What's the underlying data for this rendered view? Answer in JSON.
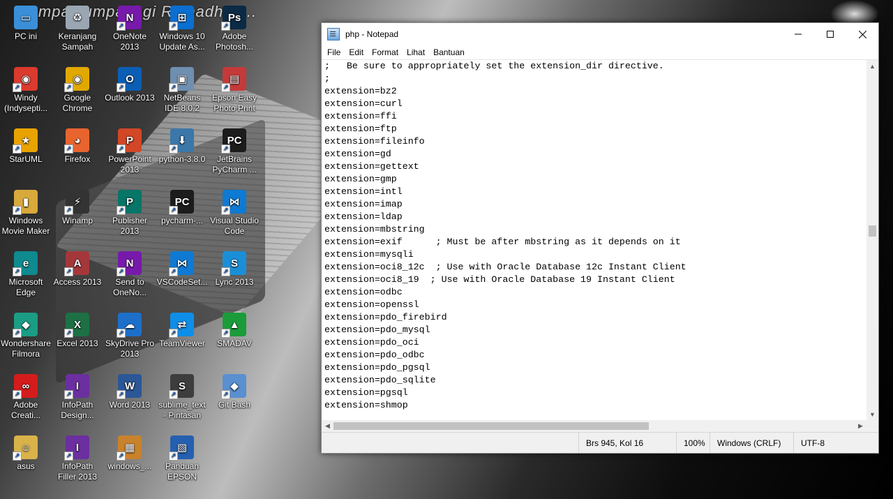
{
  "desktop": {
    "banner": "Sampai jumpa lagi Ramadhan...",
    "icons": [
      {
        "label": "PC ini",
        "icon": "pc-icon",
        "color": "#3a8fd8",
        "glyph": "▭"
      },
      {
        "label": "Keranjang Sampah",
        "icon": "recycle-bin-icon",
        "color": "#9aa7b3",
        "glyph": "♻"
      },
      {
        "label": "OneNote 2013",
        "icon": "onenote-icon",
        "color": "#7719aa",
        "glyph": "N"
      },
      {
        "label": "Windows 10 Update As...",
        "icon": "windows-update-icon",
        "color": "#0a6fd1",
        "glyph": "⊞"
      },
      {
        "label": "Adobe Photosh...",
        "icon": "photoshop-icon",
        "color": "#0b2a45",
        "glyph": "Ps"
      },
      {
        "label": "Windy (Indysepti...",
        "icon": "chrome-profile-icon",
        "color": "#db3a2e",
        "glyph": "◉"
      },
      {
        "label": "Google Chrome",
        "icon": "chrome-icon",
        "color": "#e1a800",
        "glyph": "◉"
      },
      {
        "label": "Outlook 2013",
        "icon": "outlook-icon",
        "color": "#0a5fb5",
        "glyph": "O"
      },
      {
        "label": "NetBeans IDE 8.0.2",
        "icon": "netbeans-icon",
        "color": "#6f8fb0",
        "glyph": "▣"
      },
      {
        "label": "Epson Easy Photo Print",
        "icon": "epson-photo-icon",
        "color": "#c43a3a",
        "glyph": "▤"
      },
      {
        "label": "StarUML",
        "icon": "staruml-icon",
        "color": "#e8a300",
        "glyph": "★"
      },
      {
        "label": "Firefox",
        "icon": "firefox-icon",
        "color": "#e8642e",
        "glyph": "◕"
      },
      {
        "label": "PowerPoint 2013",
        "icon": "powerpoint-icon",
        "color": "#d24726",
        "glyph": "P"
      },
      {
        "label": "python-3.8.0",
        "icon": "python-installer-icon",
        "color": "#3b77a8",
        "glyph": "⬇"
      },
      {
        "label": "JetBrains PyCharm ...",
        "icon": "pycharm-icon",
        "color": "#1c1c1c",
        "glyph": "PC"
      },
      {
        "label": "Windows Movie Maker",
        "icon": "movie-maker-icon",
        "color": "#d8a93b",
        "glyph": "▮"
      },
      {
        "label": "Winamp",
        "icon": "winamp-icon",
        "color": "#333333",
        "glyph": "⚡"
      },
      {
        "label": "Publisher 2013",
        "icon": "publisher-icon",
        "color": "#077568",
        "glyph": "P"
      },
      {
        "label": "pycharm-...",
        "icon": "pycharm-installer-icon",
        "color": "#1c1c1c",
        "glyph": "PC"
      },
      {
        "label": "Visual Studio Code",
        "icon": "vscode-icon",
        "color": "#0e7ad3",
        "glyph": "⋈"
      },
      {
        "label": "Microsoft Edge",
        "icon": "edge-icon",
        "color": "#0f8a8f",
        "glyph": "e"
      },
      {
        "label": "Access 2013",
        "icon": "access-icon",
        "color": "#a4373a",
        "glyph": "A"
      },
      {
        "label": "Send to OneNo...",
        "icon": "send-to-onenote-icon",
        "color": "#7719aa",
        "glyph": "N"
      },
      {
        "label": "VSCodeSet...",
        "icon": "vscode-setup-icon",
        "color": "#0e7ad3",
        "glyph": "⋈"
      },
      {
        "label": "Lync 2013",
        "icon": "lync-icon",
        "color": "#1a8fd8",
        "glyph": "S"
      },
      {
        "label": "Wondershare Filmora",
        "icon": "filmora-icon",
        "color": "#1b9c85",
        "glyph": "◆"
      },
      {
        "label": "Excel 2013",
        "icon": "excel-icon",
        "color": "#1d7044",
        "glyph": "X"
      },
      {
        "label": "SkyDrive Pro 2013",
        "icon": "skydrive-icon",
        "color": "#1e6fc9",
        "glyph": "☁"
      },
      {
        "label": "TeamViewer",
        "icon": "teamviewer-icon",
        "color": "#0e8ee9",
        "glyph": "⇄"
      },
      {
        "label": "SMADAV",
        "icon": "smadav-icon",
        "color": "#1b9c3a",
        "glyph": "▲"
      },
      {
        "label": "Adobe Creati...",
        "icon": "adobe-cc-icon",
        "color": "#d41c1c",
        "glyph": "∞"
      },
      {
        "label": "InfoPath Design...",
        "icon": "infopath-designer-icon",
        "color": "#6b2fa0",
        "glyph": "I"
      },
      {
        "label": "Word 2013",
        "icon": "word-icon",
        "color": "#2b5797",
        "glyph": "W"
      },
      {
        "label": "sublime_text - Pintasan",
        "icon": "sublime-icon",
        "color": "#3d3d3d",
        "glyph": "S"
      },
      {
        "label": "Git Bash",
        "icon": "git-bash-icon",
        "color": "#5a8fd0",
        "glyph": "◆"
      },
      {
        "label": "asus",
        "icon": "user-folder-icon",
        "color": "#d9b24a",
        "glyph": "☺"
      },
      {
        "label": "InfoPath Filler 2013",
        "icon": "infopath-filler-icon",
        "color": "#6b2fa0",
        "glyph": "I"
      },
      {
        "label": "windows_...",
        "icon": "windows-file-icon",
        "color": "#c9822c",
        "glyph": "▦"
      },
      {
        "label": "Panduan EPSON",
        "icon": "epson-manual-icon",
        "color": "#2560b0",
        "glyph": "▧"
      }
    ]
  },
  "notepad": {
    "title": "php - Notepad",
    "menu": [
      "File",
      "Edit",
      "Format",
      "Lihat",
      "Bantuan"
    ],
    "lines": [
      ";   Be sure to appropriately set the extension_dir directive.",
      ";",
      "extension=bz2",
      "extension=curl",
      "extension=ffi",
      "extension=ftp",
      "extension=fileinfo",
      "extension=gd",
      "extension=gettext",
      "extension=gmp",
      "extension=intl",
      "extension=imap",
      "extension=ldap",
      "extension=mbstring",
      "extension=exif      ; Must be after mbstring as it depends on it",
      "extension=mysqli",
      "extension=oci8_12c  ; Use with Oracle Database 12c Instant Client",
      "extension=oci8_19  ; Use with Oracle Database 19 Instant Client",
      "extension=odbc",
      "extension=openssl",
      "extension=pdo_firebird",
      "extension=pdo_mysql",
      "extension=pdo_oci",
      "extension=pdo_odbc",
      "extension=pdo_pgsql",
      "extension=pdo_sqlite",
      "extension=pgsql",
      "extension=shmop"
    ],
    "status": {
      "position": "Brs 945, Kol 16",
      "zoom": "100%",
      "line_ending": "Windows (CRLF)",
      "encoding": "UTF-8"
    }
  }
}
